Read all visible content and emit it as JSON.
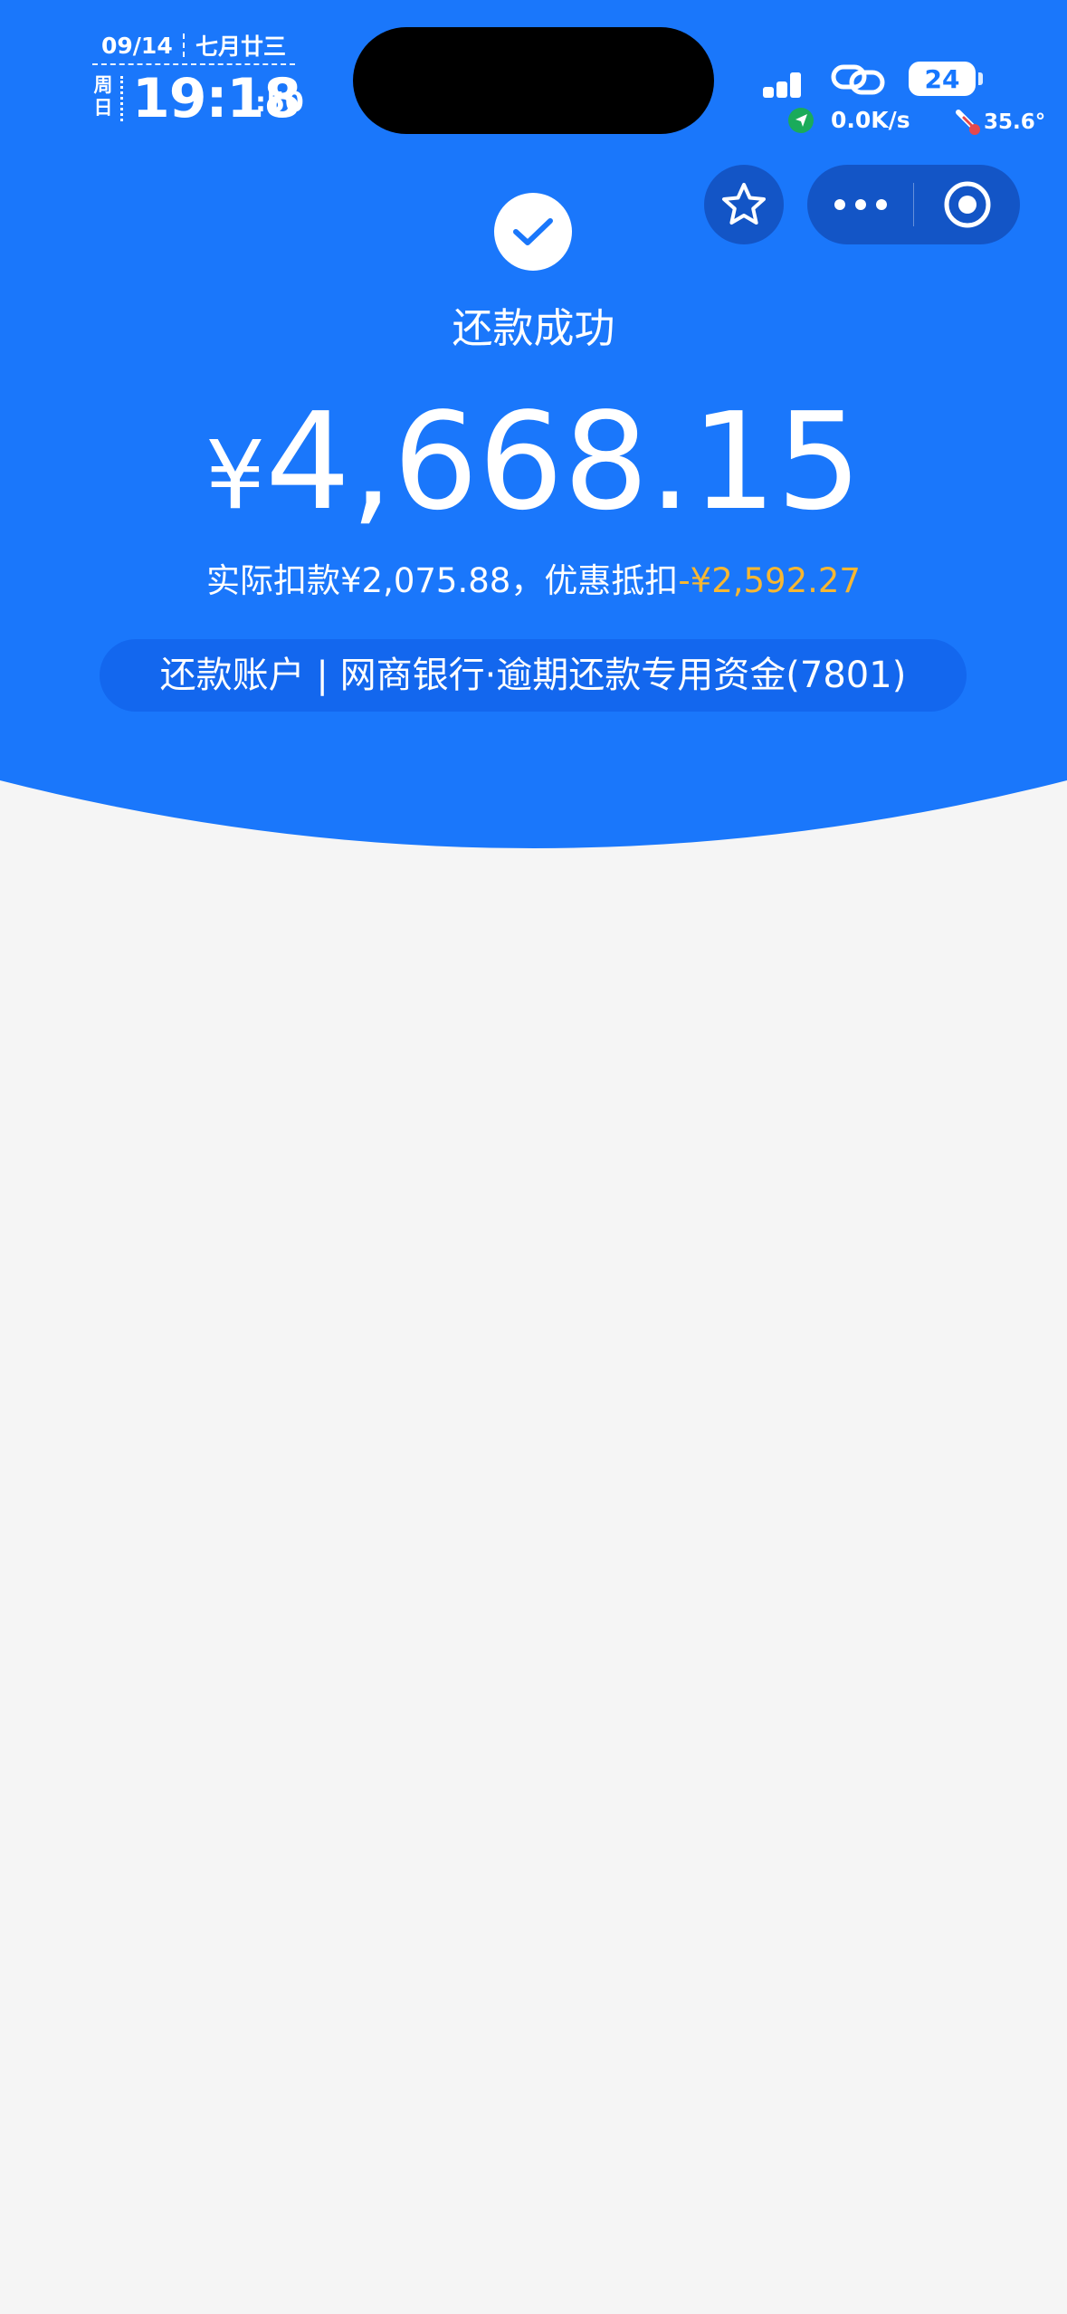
{
  "status_bar": {
    "date": "09/14",
    "lunar_date": "七月廿三",
    "weekday": "周日",
    "time": "19:18",
    "seconds": ":50",
    "battery_level": "24",
    "network_speed": "0.0K/s",
    "temperature": "35.6°"
  },
  "capsule": {
    "favorite_icon": "star-icon",
    "more_icon": "more-dots-icon",
    "close_icon": "target-circle-icon"
  },
  "result": {
    "title": "还款成功",
    "currency_symbol": "¥",
    "amount": "4,668.15",
    "actual_label": "实际扣款¥2,075.88，",
    "discount_label": "优惠抵扣",
    "discount_value": "-¥2,592.27",
    "account": "还款账户 | 网商银行·逾期还款专用资金(7801)"
  },
  "colors": {
    "brand_blue": "#1a77fb",
    "capsule_blue": "#1355c6",
    "pill_blue": "#1367ee",
    "discount_orange": "#f7b731",
    "page_background": "#f5f5f5"
  }
}
